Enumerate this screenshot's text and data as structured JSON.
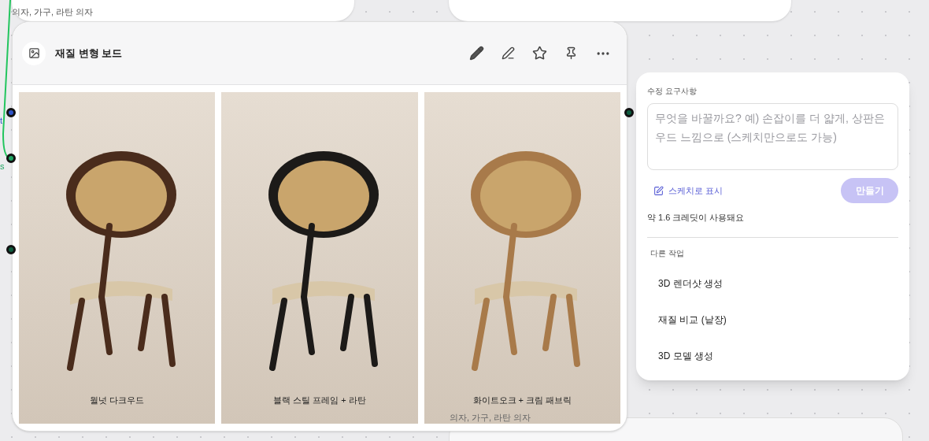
{
  "top_left_card": {
    "tags": "의자, 가구, 라탄 의자"
  },
  "ports": [
    {
      "label": "t",
      "color": "#2f54c8"
    },
    {
      "label": "s",
      "color": "#1fa463"
    },
    {
      "color": "#0f5c3f"
    }
  ],
  "board": {
    "title": "재질 변형 보드",
    "variants": [
      {
        "caption": "월넛 다크우드",
        "color": "#4a2c1c"
      },
      {
        "caption": "블랙 스틸 프레임 + 라탄",
        "color": "#1c1a18"
      },
      {
        "caption": "화이트오크 + 크림 패브릭",
        "color": "#a87a4a"
      }
    ],
    "overlay_tags": "의자, 가구, 라탄 의자"
  },
  "edit_panel": {
    "label": "수정 요구사항",
    "placeholder": "무엇을 바꿀까요? 예) 손잡이를 더 얇게, 상판은 우드 느낌으로 (스케치만으로도 가능)",
    "sketch_link": "스케치로 표시",
    "create_button": {
      "label": "만들기",
      "disabled": true
    },
    "credits": "약 1.6 크레딧이 사용돼요",
    "other_label": "다른 작업",
    "actions": [
      "3D 렌더샷 생성",
      "재질 비교 (낱장)",
      "3D 모델 생성"
    ]
  }
}
